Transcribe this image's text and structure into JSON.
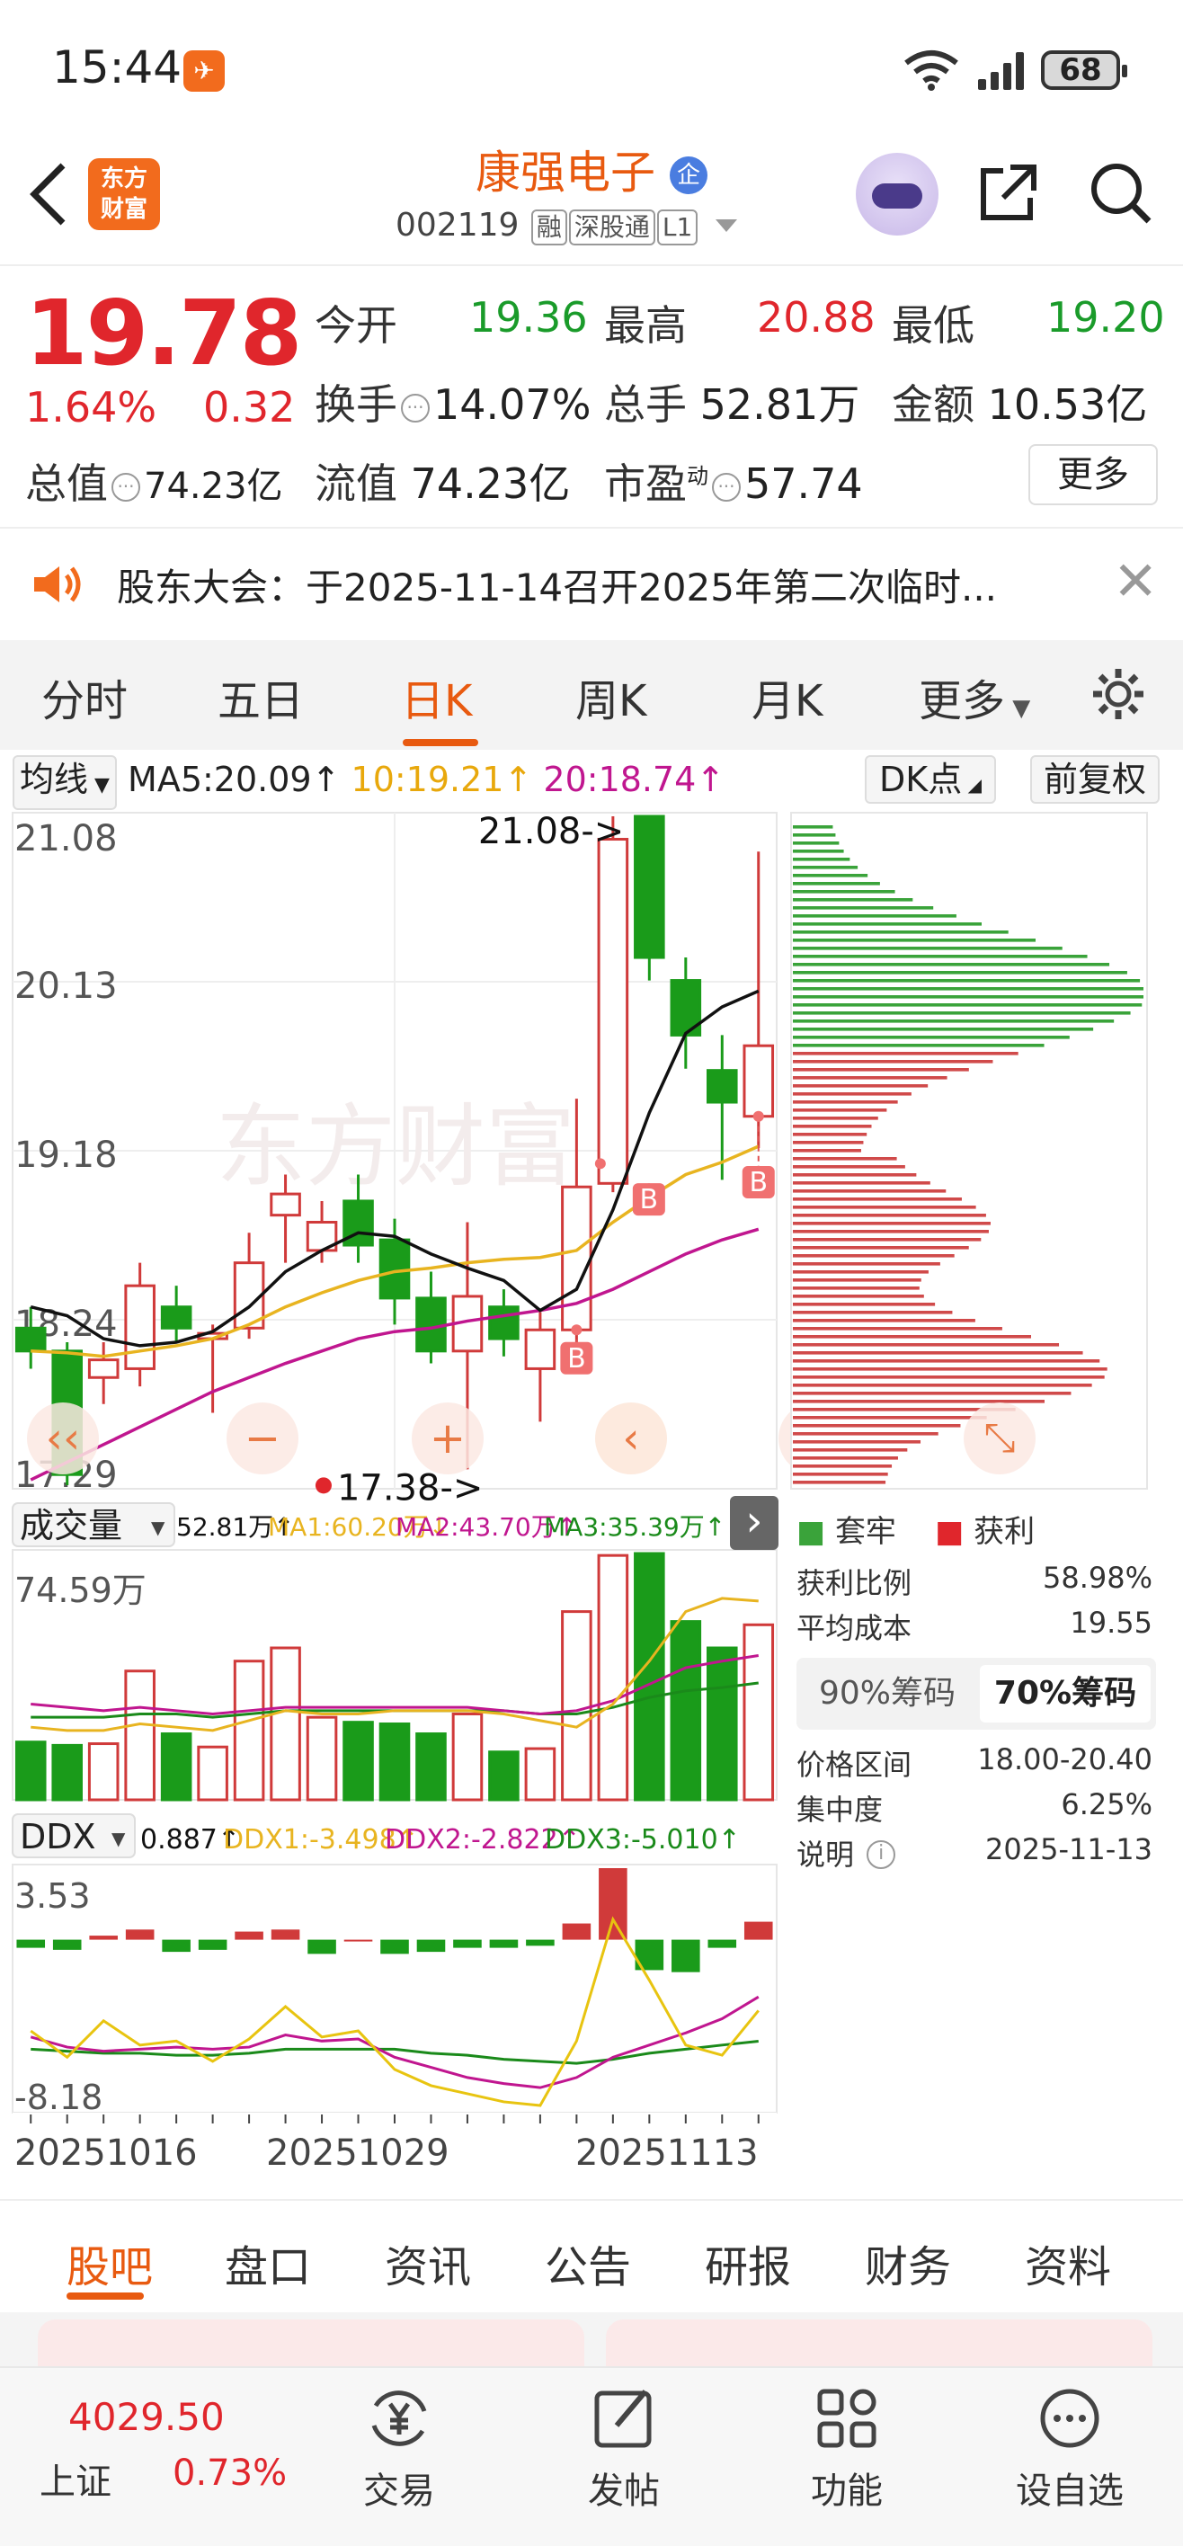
{
  "status_bar": {
    "time": "15:44",
    "battery": "68"
  },
  "header": {
    "back_icon": "chevron-left-icon",
    "logo_text": "东方\n财富",
    "stock_name": "康强电子",
    "name_badge": "企",
    "code": "002119",
    "tags": [
      "融",
      "深股通",
      "L1"
    ]
  },
  "quote": {
    "price": "19.78",
    "change_pct": "1.64%",
    "change": "0.32",
    "fields": [
      {
        "label": "今开",
        "value": "19.36",
        "color": "green"
      },
      {
        "label": "最高",
        "value": "20.88",
        "color": "red"
      },
      {
        "label": "最低",
        "value": "19.20",
        "color": "green"
      },
      {
        "label": "换手",
        "value": "14.07%",
        "color": "black"
      },
      {
        "label": "总手",
        "value": "52.81万",
        "color": "black"
      },
      {
        "label": "金额",
        "value": "10.53亿",
        "color": "black"
      },
      {
        "label": "总值",
        "value": "74.23亿",
        "color": "black"
      },
      {
        "label": "流值",
        "value": "74.23亿",
        "color": "black"
      },
      {
        "label": "市盈",
        "value": "57.74",
        "color": "black",
        "sup": "动"
      }
    ],
    "more_label": "更多"
  },
  "notice": {
    "text": "股东大会：于2025-11-14召开2025年第二次临时..."
  },
  "period_tabs": {
    "items": [
      "分时",
      "五日",
      "日K",
      "周K",
      "月K",
      "更多"
    ],
    "active": "日K"
  },
  "ma_bar": {
    "selector": "均线",
    "ma5": "MA5:20.09↑",
    "ma10": "10:19.21↑",
    "ma20": "20:18.74↑",
    "dk_label": "DK点",
    "fq_label": "前复权"
  },
  "kline": {
    "y_ticks": [
      "21.08",
      "20.13",
      "19.18",
      "18.24",
      "17.29"
    ],
    "high_label": "21.08->",
    "low_label": "17.38->",
    "watermark": "东方财富",
    "buy_marker": "B"
  },
  "volume": {
    "selector": "成交量",
    "total": "52.81万↑",
    "ma1": "MA1:60.20万↓",
    "ma2": "MA2:43.70万↑",
    "ma3": "MA3:35.39万↑",
    "y_max": "74.59万"
  },
  "ddx": {
    "selector": "DDX",
    "value": "0.887↑",
    "ddx1": "DDX1:-3.498↑",
    "ddx2": "DDX2:-2.822↑",
    "ddx3": "DDX3:-5.010↑",
    "y_max": "3.53",
    "y_min": "-8.18"
  },
  "x_dates": [
    "20251016",
    "20251029",
    "20251113"
  ],
  "chip": {
    "legend_trapped": "套牢",
    "legend_profit": "获利",
    "rows": [
      {
        "label": "获利比例",
        "value": "58.98%"
      },
      {
        "label": "平均成本",
        "value": "19.55"
      }
    ],
    "tabs": [
      "90%筹码",
      "70%筹码"
    ],
    "active_tab": "70%筹码",
    "rows2": [
      {
        "label": "价格区间",
        "value": "18.00-20.40"
      },
      {
        "label": "集中度",
        "value": "6.25%"
      },
      {
        "label": "说明",
        "value": "2025-11-13"
      }
    ]
  },
  "chart_data": [
    {
      "type": "candlestick",
      "title": "日K",
      "ylim": [
        17.29,
        21.08
      ],
      "candles": [
        {
          "o": 18.18,
          "c": 18.05,
          "h": 18.3,
          "l": 17.95
        },
        {
          "o": 18.05,
          "c": 17.35,
          "h": 18.1,
          "l": 17.29
        },
        {
          "o": 17.9,
          "c": 18.0,
          "h": 18.1,
          "l": 17.75
        },
        {
          "o": 17.95,
          "c": 18.42,
          "h": 18.55,
          "l": 17.85
        },
        {
          "o": 18.3,
          "c": 18.18,
          "h": 18.42,
          "l": 18.1
        },
        {
          "o": 18.12,
          "c": 18.15,
          "h": 18.2,
          "l": 17.7
        },
        {
          "o": 18.18,
          "c": 18.55,
          "h": 18.72,
          "l": 18.12
        },
        {
          "o": 18.82,
          "c": 18.94,
          "h": 19.05,
          "l": 18.55
        },
        {
          "o": 18.62,
          "c": 18.78,
          "h": 18.9,
          "l": 18.55
        },
        {
          "o": 18.9,
          "c": 18.65,
          "h": 19.05,
          "l": 18.55
        },
        {
          "o": 18.68,
          "c": 18.35,
          "h": 18.8,
          "l": 18.2
        },
        {
          "o": 18.35,
          "c": 18.05,
          "h": 18.5,
          "l": 17.98
        },
        {
          "o": 18.05,
          "c": 18.36,
          "h": 18.78,
          "l": 17.38
        },
        {
          "o": 18.3,
          "c": 18.12,
          "h": 18.4,
          "l": 18.02
        },
        {
          "o": 17.95,
          "c": 18.17,
          "h": 18.27,
          "l": 17.65
        },
        {
          "o": 18.17,
          "c": 18.98,
          "h": 19.48,
          "l": 18.05
        },
        {
          "o": 19.0,
          "c": 20.95,
          "h": 21.08,
          "l": 18.95
        },
        {
          "o": 21.08,
          "c": 20.28,
          "h": 21.08,
          "l": 20.15
        },
        {
          "o": 20.15,
          "c": 19.84,
          "h": 20.28,
          "l": 19.65
        },
        {
          "o": 19.64,
          "c": 19.46,
          "h": 19.84,
          "l": 19.02
        },
        {
          "o": 19.38,
          "c": 19.78,
          "h": 20.88,
          "l": 19.2
        }
      ],
      "ma5": [
        18.3,
        18.25,
        18.12,
        18.08,
        18.1,
        18.16,
        18.3,
        18.5,
        18.62,
        18.72,
        18.7,
        18.6,
        18.52,
        18.45,
        18.28,
        18.4,
        18.85,
        19.4,
        19.85,
        20.0,
        20.09
      ],
      "ma10": [
        18.05,
        18.04,
        18.02,
        18.05,
        18.08,
        18.12,
        18.2,
        18.3,
        18.38,
        18.45,
        18.5,
        18.52,
        18.55,
        18.57,
        18.58,
        18.62,
        18.78,
        18.92,
        19.05,
        19.12,
        19.21
      ],
      "ma20": [
        17.32,
        17.42,
        17.52,
        17.62,
        17.72,
        17.82,
        17.9,
        17.98,
        18.05,
        18.12,
        18.16,
        18.18,
        18.22,
        18.25,
        18.28,
        18.32,
        18.4,
        18.5,
        18.6,
        18.68,
        18.74
      ],
      "buy_points": [
        15,
        16,
        20
      ]
    },
    {
      "type": "bar",
      "title": "成交量",
      "ylim": [
        0,
        74.59
      ],
      "values": [
        17.5,
        16.5,
        17,
        39,
        20,
        16,
        42,
        46,
        25,
        23.5,
        23,
        20,
        26,
        14.5,
        15.5,
        57,
        74,
        74.59,
        54,
        46,
        53
      ],
      "ma1": [
        22,
        21,
        21,
        23,
        22,
        21,
        24,
        27,
        26,
        26,
        27,
        27,
        27,
        26,
        24,
        22,
        29,
        42,
        57,
        61,
        60.2
      ],
      "ma2": [
        29,
        28,
        27,
        28,
        27,
        26,
        27,
        28,
        28,
        28,
        28,
        28,
        28,
        27,
        26,
        27,
        30,
        35,
        40,
        42,
        43.7
      ],
      "ma3": [
        25,
        25,
        25,
        26,
        26,
        25,
        26,
        27,
        27,
        27,
        27,
        27,
        27,
        27,
        26,
        26,
        28,
        31,
        33,
        34,
        35.39
      ]
    },
    {
      "type": "bar",
      "title": "DDX",
      "ylim": [
        -8.18,
        3.53
      ],
      "values": [
        -0.4,
        -0.5,
        0.2,
        0.5,
        -0.6,
        -0.5,
        0.4,
        0.5,
        -0.7,
        0.0,
        -0.7,
        -0.6,
        -0.4,
        -0.4,
        -0.3,
        0.8,
        3.53,
        -1.5,
        -1.6,
        -0.4,
        0.887
      ],
      "ddx1": [
        -4.5,
        -5.8,
        -4.0,
        -5.2,
        -5.0,
        -6.0,
        -4.9,
        -3.3,
        -4.8,
        -4.5,
        -6.4,
        -7.2,
        -7.6,
        -8.0,
        -8.18,
        -5.0,
        1.0,
        -2.0,
        -5.2,
        -5.7,
        -3.498
      ],
      "ddx2": [
        -4.8,
        -5.3,
        -5.5,
        -5.4,
        -5.3,
        -5.4,
        -5.3,
        -4.7,
        -5.0,
        -4.9,
        -5.8,
        -6.3,
        -6.8,
        -7.1,
        -7.3,
        -6.8,
        -5.8,
        -5.2,
        -4.6,
        -3.9,
        -2.822
      ],
      "ddx3": [
        -5.4,
        -5.5,
        -5.6,
        -5.6,
        -5.7,
        -5.7,
        -5.6,
        -5.4,
        -5.4,
        -5.4,
        -5.4,
        -5.6,
        -5.7,
        -5.9,
        -6.0,
        -6.1,
        -5.9,
        -5.6,
        -5.4,
        -5.2,
        -5.01
      ]
    }
  ],
  "info_tabs": {
    "items": [
      "股吧",
      "盘口",
      "资讯",
      "公告",
      "研报",
      "财务",
      "资料"
    ],
    "active": "股吧"
  },
  "bottom_nav": {
    "index_value": "4029.50",
    "index_name": "上证",
    "index_pct": "0.73%",
    "items": [
      {
        "label": "交易",
        "icon": "yen-cycle-icon"
      },
      {
        "label": "发帖",
        "icon": "edit-icon"
      },
      {
        "label": "功能",
        "icon": "grid-icon"
      },
      {
        "label": "设自选",
        "icon": "more-dots-icon"
      }
    ]
  }
}
